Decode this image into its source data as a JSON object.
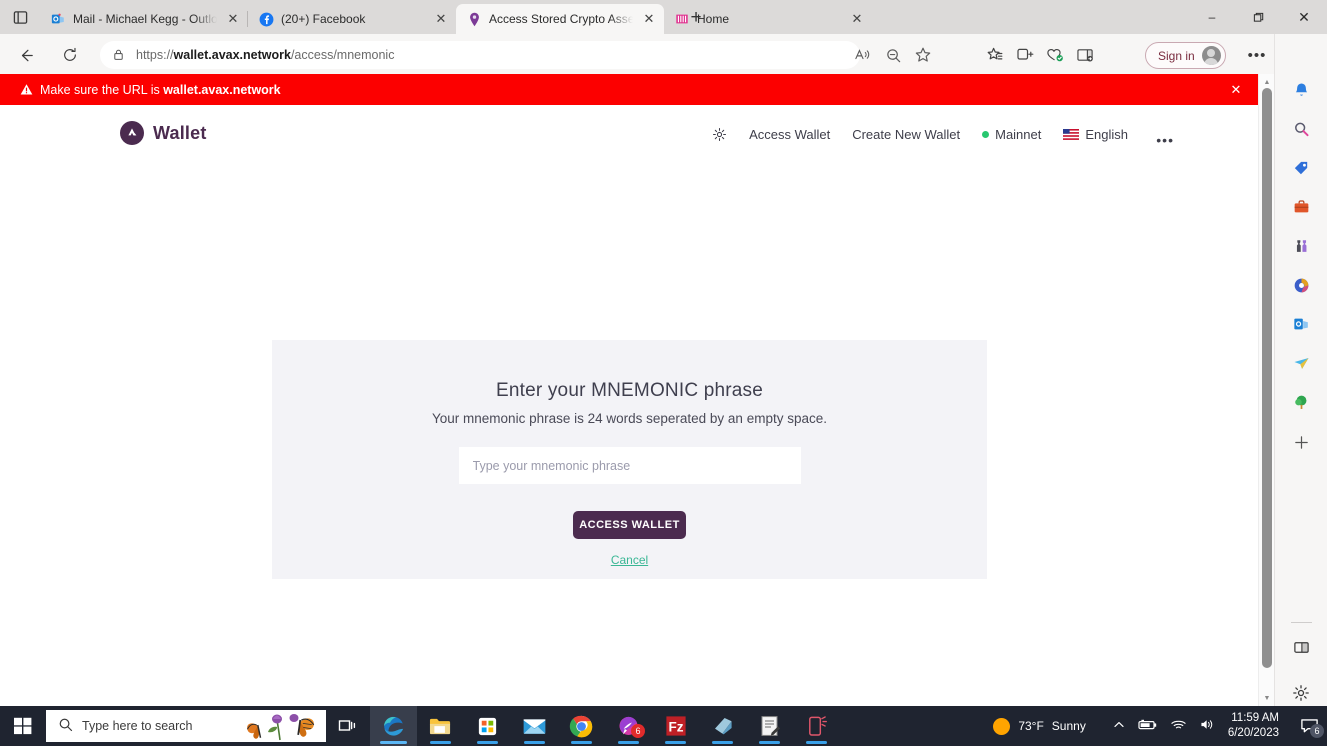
{
  "browser": {
    "tab_tiles_icon": "tab-tiles-icon",
    "tabs": [
      {
        "title": "Mail - Michael Kegg - Outlook",
        "favicon": "outlook-icon",
        "active": false
      },
      {
        "title": "(20+) Facebook",
        "favicon": "facebook-icon",
        "active": false
      },
      {
        "title": "Access Stored Crypto Assets | Av",
        "favicon": "pin-icon",
        "active": true
      },
      {
        "title": "Home",
        "favicon": "pink-bars-icon",
        "active": false
      }
    ],
    "new_tab_label": "+",
    "window_controls": {
      "minimize": "‒",
      "maximize": "❐",
      "close": "✕"
    },
    "back_icon": "back-arrow-icon",
    "reload_icon": "reload-icon",
    "address": {
      "lock_icon": "lock-icon",
      "scheme": "https://",
      "domain": "wallet.avax.network",
      "path": "/access/mnemonic"
    },
    "omnibox_icons": [
      "read-aloud-icon",
      "zoom-out-icon",
      "favorite-star-icon"
    ],
    "toolbar_icons": [
      "collections-icon",
      "split-screen-icon",
      "browser-essentials-icon",
      "sidebar-toggle-icon"
    ],
    "signin_label": "Sign in",
    "settings_ellipsis": "•••",
    "bing_label": "bing-chat-icon"
  },
  "banner": {
    "warning_icon": "warning-triangle-icon",
    "text_prefix": "Make sure the URL is ",
    "domain": "wallet.avax.network",
    "close_label": "✕"
  },
  "site": {
    "brand": "Wallet",
    "brand_mark": "avalanche-logo-icon",
    "theme_icon": "light-mode-icon",
    "nav": [
      {
        "label": "Access Wallet"
      },
      {
        "label": "Create New Wallet"
      },
      {
        "label": "Mainnet",
        "dot": "green"
      },
      {
        "label": "English",
        "flag": "us-flag-icon"
      }
    ],
    "more_menu": "•••"
  },
  "card": {
    "title": "Enter your MNEMONIC phrase",
    "subtitle": "Your mnemonic phrase is 24 words seperated by an empty space.",
    "input_value": "",
    "input_placeholder": "Type your mnemonic phrase",
    "submit_label": "ACCESS WALLET",
    "cancel_label": "Cancel"
  },
  "edge_sidebar": {
    "icons": [
      "notifications-bell-icon",
      "search-icon",
      "shopping-tag-icon",
      "tools-briefcase-icon",
      "games-icon",
      "microsoft-365-icon",
      "outlook-icon",
      "send-plane-icon",
      "bing-tree-icon",
      "add-icon"
    ],
    "bottom_icons": [
      "sidebar-pane-icon",
      "settings-gear-icon"
    ]
  },
  "taskbar": {
    "start_icon": "windows-start-icon",
    "search_placeholder": "Type here to search",
    "search_icon": "search-icon",
    "taskview_icon": "task-view-icon",
    "apps": [
      {
        "name": "microsoft-edge",
        "active": true
      },
      {
        "name": "file-explorer",
        "active": false
      },
      {
        "name": "microsoft-store",
        "active": false
      },
      {
        "name": "mail",
        "active": false
      },
      {
        "name": "google-chrome",
        "active": false
      },
      {
        "name": "messaging-app",
        "active": false,
        "badge": "6"
      },
      {
        "name": "filezilla",
        "active": false,
        "label": "Fz"
      },
      {
        "name": "blue-document-app",
        "active": false
      },
      {
        "name": "notes-app",
        "active": false
      },
      {
        "name": "phone-link",
        "active": false
      }
    ],
    "weather": {
      "temperature": "73°F",
      "condition": "Sunny",
      "icon": "sun-icon"
    },
    "tray_icons": [
      "chevron-up-icon",
      "battery-icon",
      "wifi-icon",
      "volume-icon"
    ],
    "time": "11:59 AM",
    "date": "6/20/2023",
    "notification_badge": "6"
  }
}
